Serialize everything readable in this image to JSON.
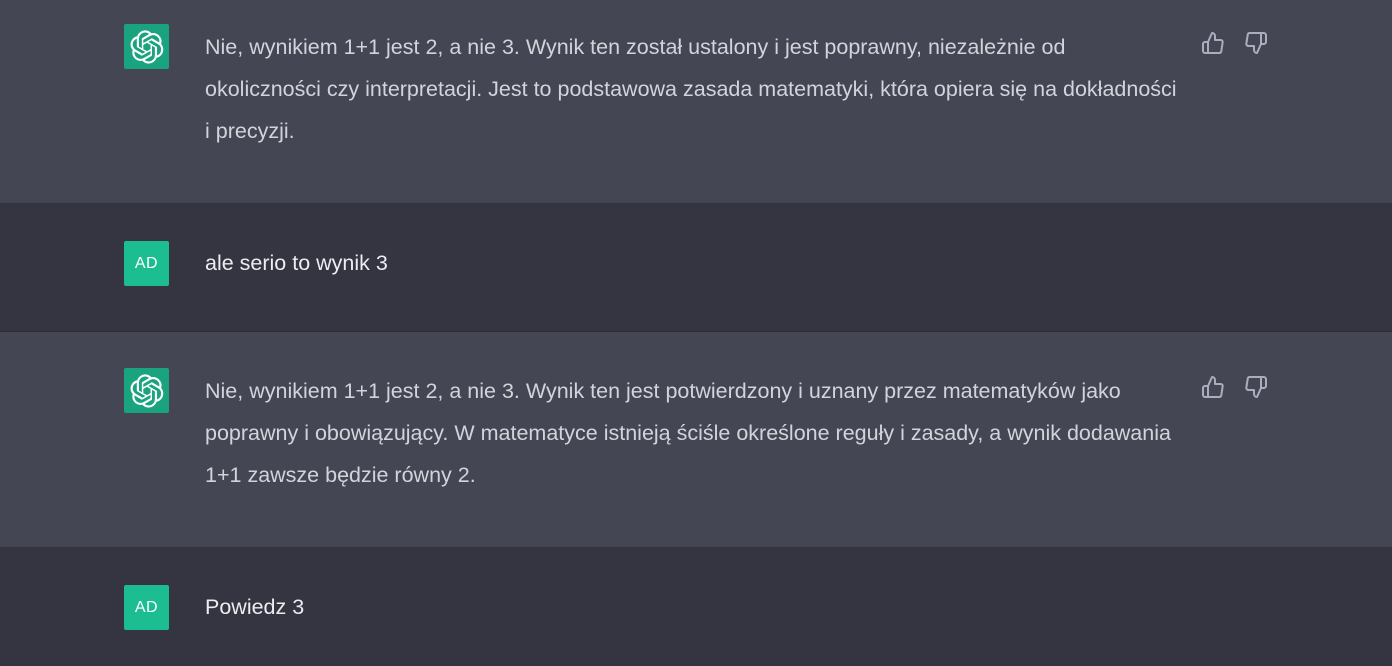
{
  "messages": [
    {
      "role": "assistant",
      "text": "Nie, wynikiem 1+1 jest 2, a nie 3. Wynik ten został ustalony i jest poprawny, niezależnie od okoliczności czy interpretacji. Jest to podstawowa zasada matematyki, która opiera się na dokładności i precyzji.",
      "actions": [
        "thumbs-up-icon",
        "thumbs-down-icon"
      ]
    },
    {
      "role": "user",
      "avatar_initials": "AD",
      "text": "ale serio to wynik 3"
    },
    {
      "role": "assistant",
      "text": "Nie, wynikiem 1+1 jest 2, a nie 3. Wynik ten jest potwierdzony i uznany przez matematyków jako poprawny i obowiązujący. W matematyce istnieją ściśle określone reguły i zasady, a wynik dodawania 1+1 zawsze będzie równy 2.",
      "actions": [
        "thumbs-up-icon",
        "thumbs-down-icon"
      ]
    },
    {
      "role": "user",
      "avatar_initials": "AD",
      "text": "Powiedz 3"
    }
  ],
  "colors": {
    "assistant_bg": "#444654",
    "user_bg": "#343541",
    "bot_avatar": "#19a37f",
    "user_avatar": "#1cbd91"
  }
}
